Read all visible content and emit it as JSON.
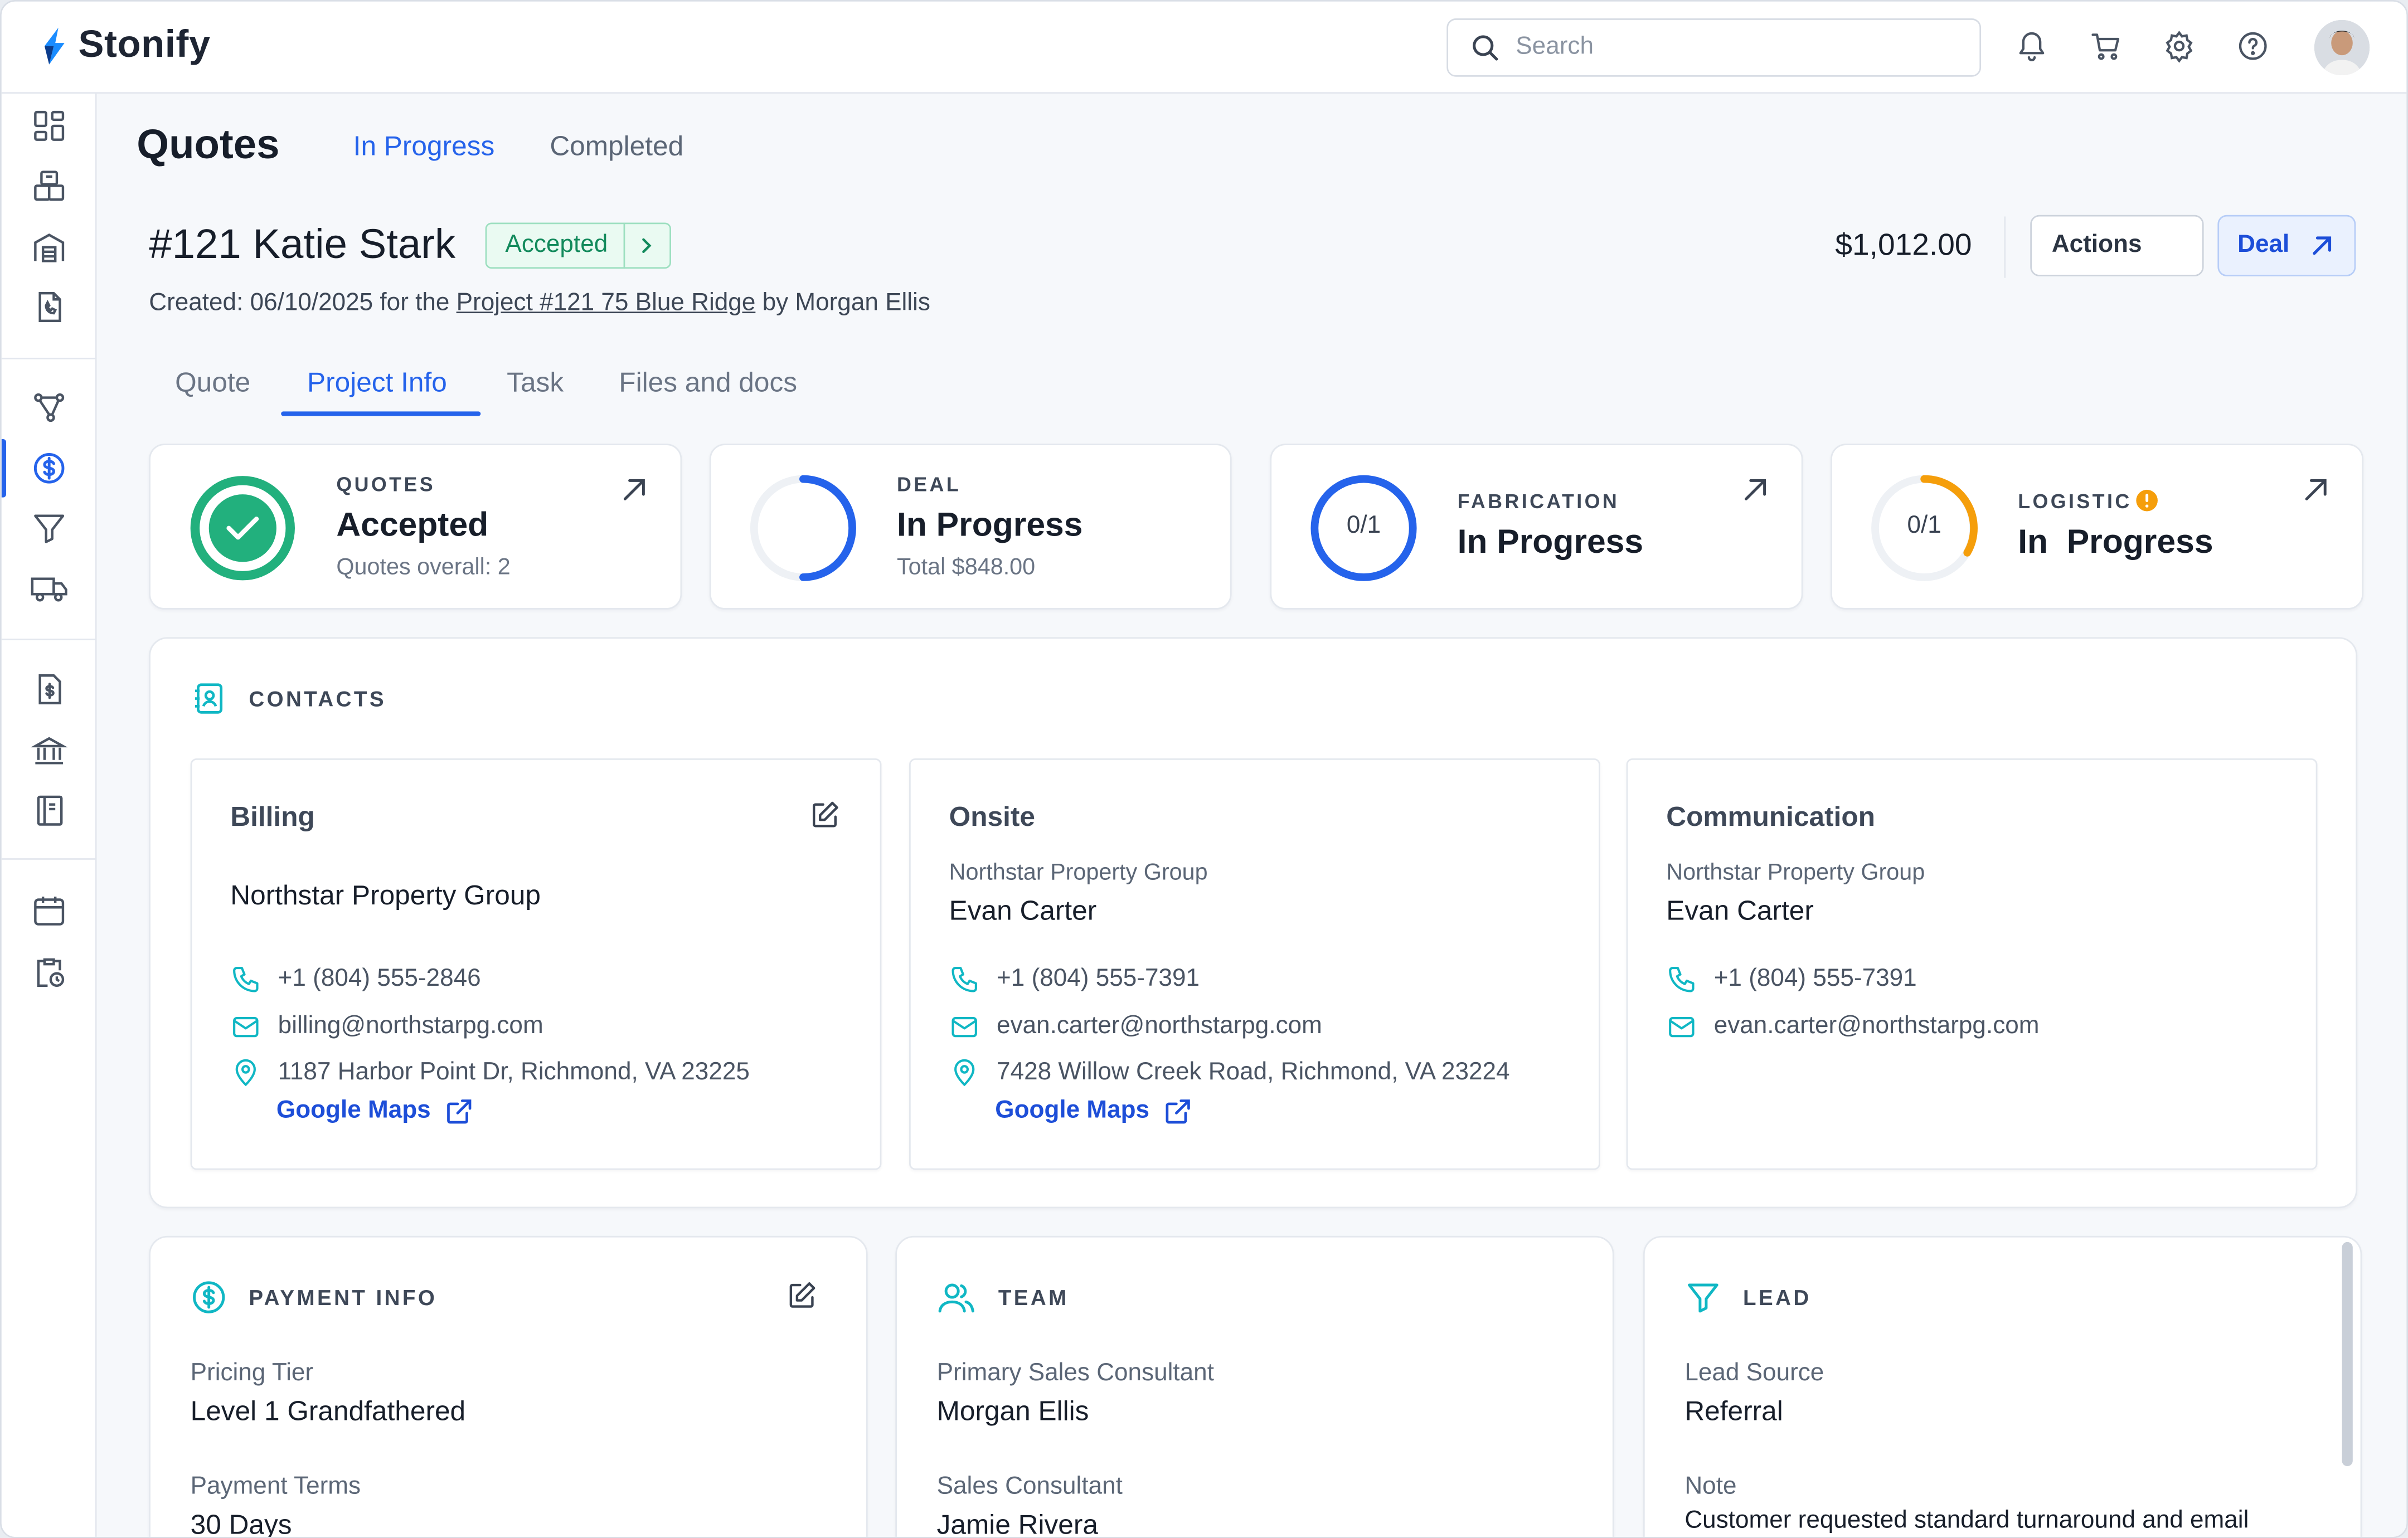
{
  "app": {
    "name": "Stonify"
  },
  "search": {
    "placeholder": "Search"
  },
  "colors": {
    "accent": "#2563eb",
    "success": "#22b07d",
    "warning": "#f59e0b",
    "icon_teal": "#10b7c4"
  },
  "sidebar": {
    "items": [
      {
        "icon": "dashboard-icon"
      },
      {
        "icon": "inventory-icon"
      },
      {
        "icon": "warehouse-icon"
      },
      {
        "icon": "phone-document-icon"
      },
      {
        "icon": "workflow-icon"
      },
      {
        "icon": "dollar-circle-icon",
        "active": true
      },
      {
        "icon": "filter-icon"
      },
      {
        "icon": "truck-icon"
      },
      {
        "icon": "invoice-icon"
      },
      {
        "icon": "bank-icon"
      },
      {
        "icon": "book-icon"
      },
      {
        "icon": "calendar-icon"
      },
      {
        "icon": "clipboard-clock-icon"
      }
    ]
  },
  "header": {
    "title": "Quotes",
    "tabs": [
      {
        "label": "In Progress",
        "active": true
      },
      {
        "label": "Completed",
        "active": false
      }
    ]
  },
  "quote": {
    "title": "#121 Katie Stark",
    "status": "Accepted",
    "created_prefix": "Created: 06/10/2025 for the ",
    "project_link": "Project #121 75 Blue Ridge",
    "created_suffix": " by Morgan Ellis",
    "amount": "$1,012.00",
    "actions_label": "Actions",
    "deal_label": "Deal"
  },
  "subtabs": [
    {
      "label": "Quote",
      "active": false
    },
    {
      "label": "Project Info",
      "active": true
    },
    {
      "label": "Task",
      "active": false
    },
    {
      "label": "Files and docs",
      "active": false
    }
  ],
  "stats": [
    {
      "label": "QUOTES",
      "value": "Accepted",
      "sub": "Quotes overall: 2",
      "progress": 1.0
    },
    {
      "label": "DEAL",
      "value": "In Progress",
      "sub": "Total $848.00",
      "progress": 0.5
    },
    {
      "label": "FABRICATION",
      "value": "In Progress",
      "ring_text": "0/1",
      "progress": 1.0
    },
    {
      "label": "LOGISTIC",
      "value": "In  Progress",
      "ring_text": "0/1",
      "progress": 0.3,
      "warning": true
    }
  ],
  "contacts": {
    "label": "CONTACTS",
    "cards": [
      {
        "title": "Billing",
        "company": "Northstar Property Group",
        "phone": "+1 (804) 555-2846",
        "email": "billing@northstarpg.com",
        "address": "1187 Harbor Point Dr, Richmond, VA 23225",
        "maps": "Google Maps"
      },
      {
        "title": "Onsite",
        "company": "Northstar Property Group",
        "name": "Evan Carter",
        "phone": "+1 (804) 555-7391",
        "email": "evan.carter@northstarpg.com",
        "address": "7428 Willow Creek Road, Richmond, VA 23224",
        "maps": "Google Maps"
      },
      {
        "title": "Communication",
        "company": "Northstar Property Group",
        "name": "Evan Carter",
        "phone": "+1 (804) 555-7391",
        "email": "evan.carter@northstarpg.com"
      }
    ]
  },
  "payment": {
    "label": "PAYMENT INFO",
    "pricing_tier_label": "Pricing Tier",
    "pricing_tier": "Level 1 Grandfathered",
    "payment_terms_label": "Payment Terms",
    "payment_terms": "30 Days"
  },
  "team": {
    "label": "TEAM",
    "primary_label": "Primary Sales Consultant",
    "primary": "Morgan Ellis",
    "consultant_label": "Sales Consultant",
    "consultant": "Jamie Rivera"
  },
  "lead": {
    "label": "LEAD",
    "source_label": "Lead Source",
    "source": "Referral",
    "note_label": "Note",
    "note": "Customer requested standard turnaround and email"
  }
}
